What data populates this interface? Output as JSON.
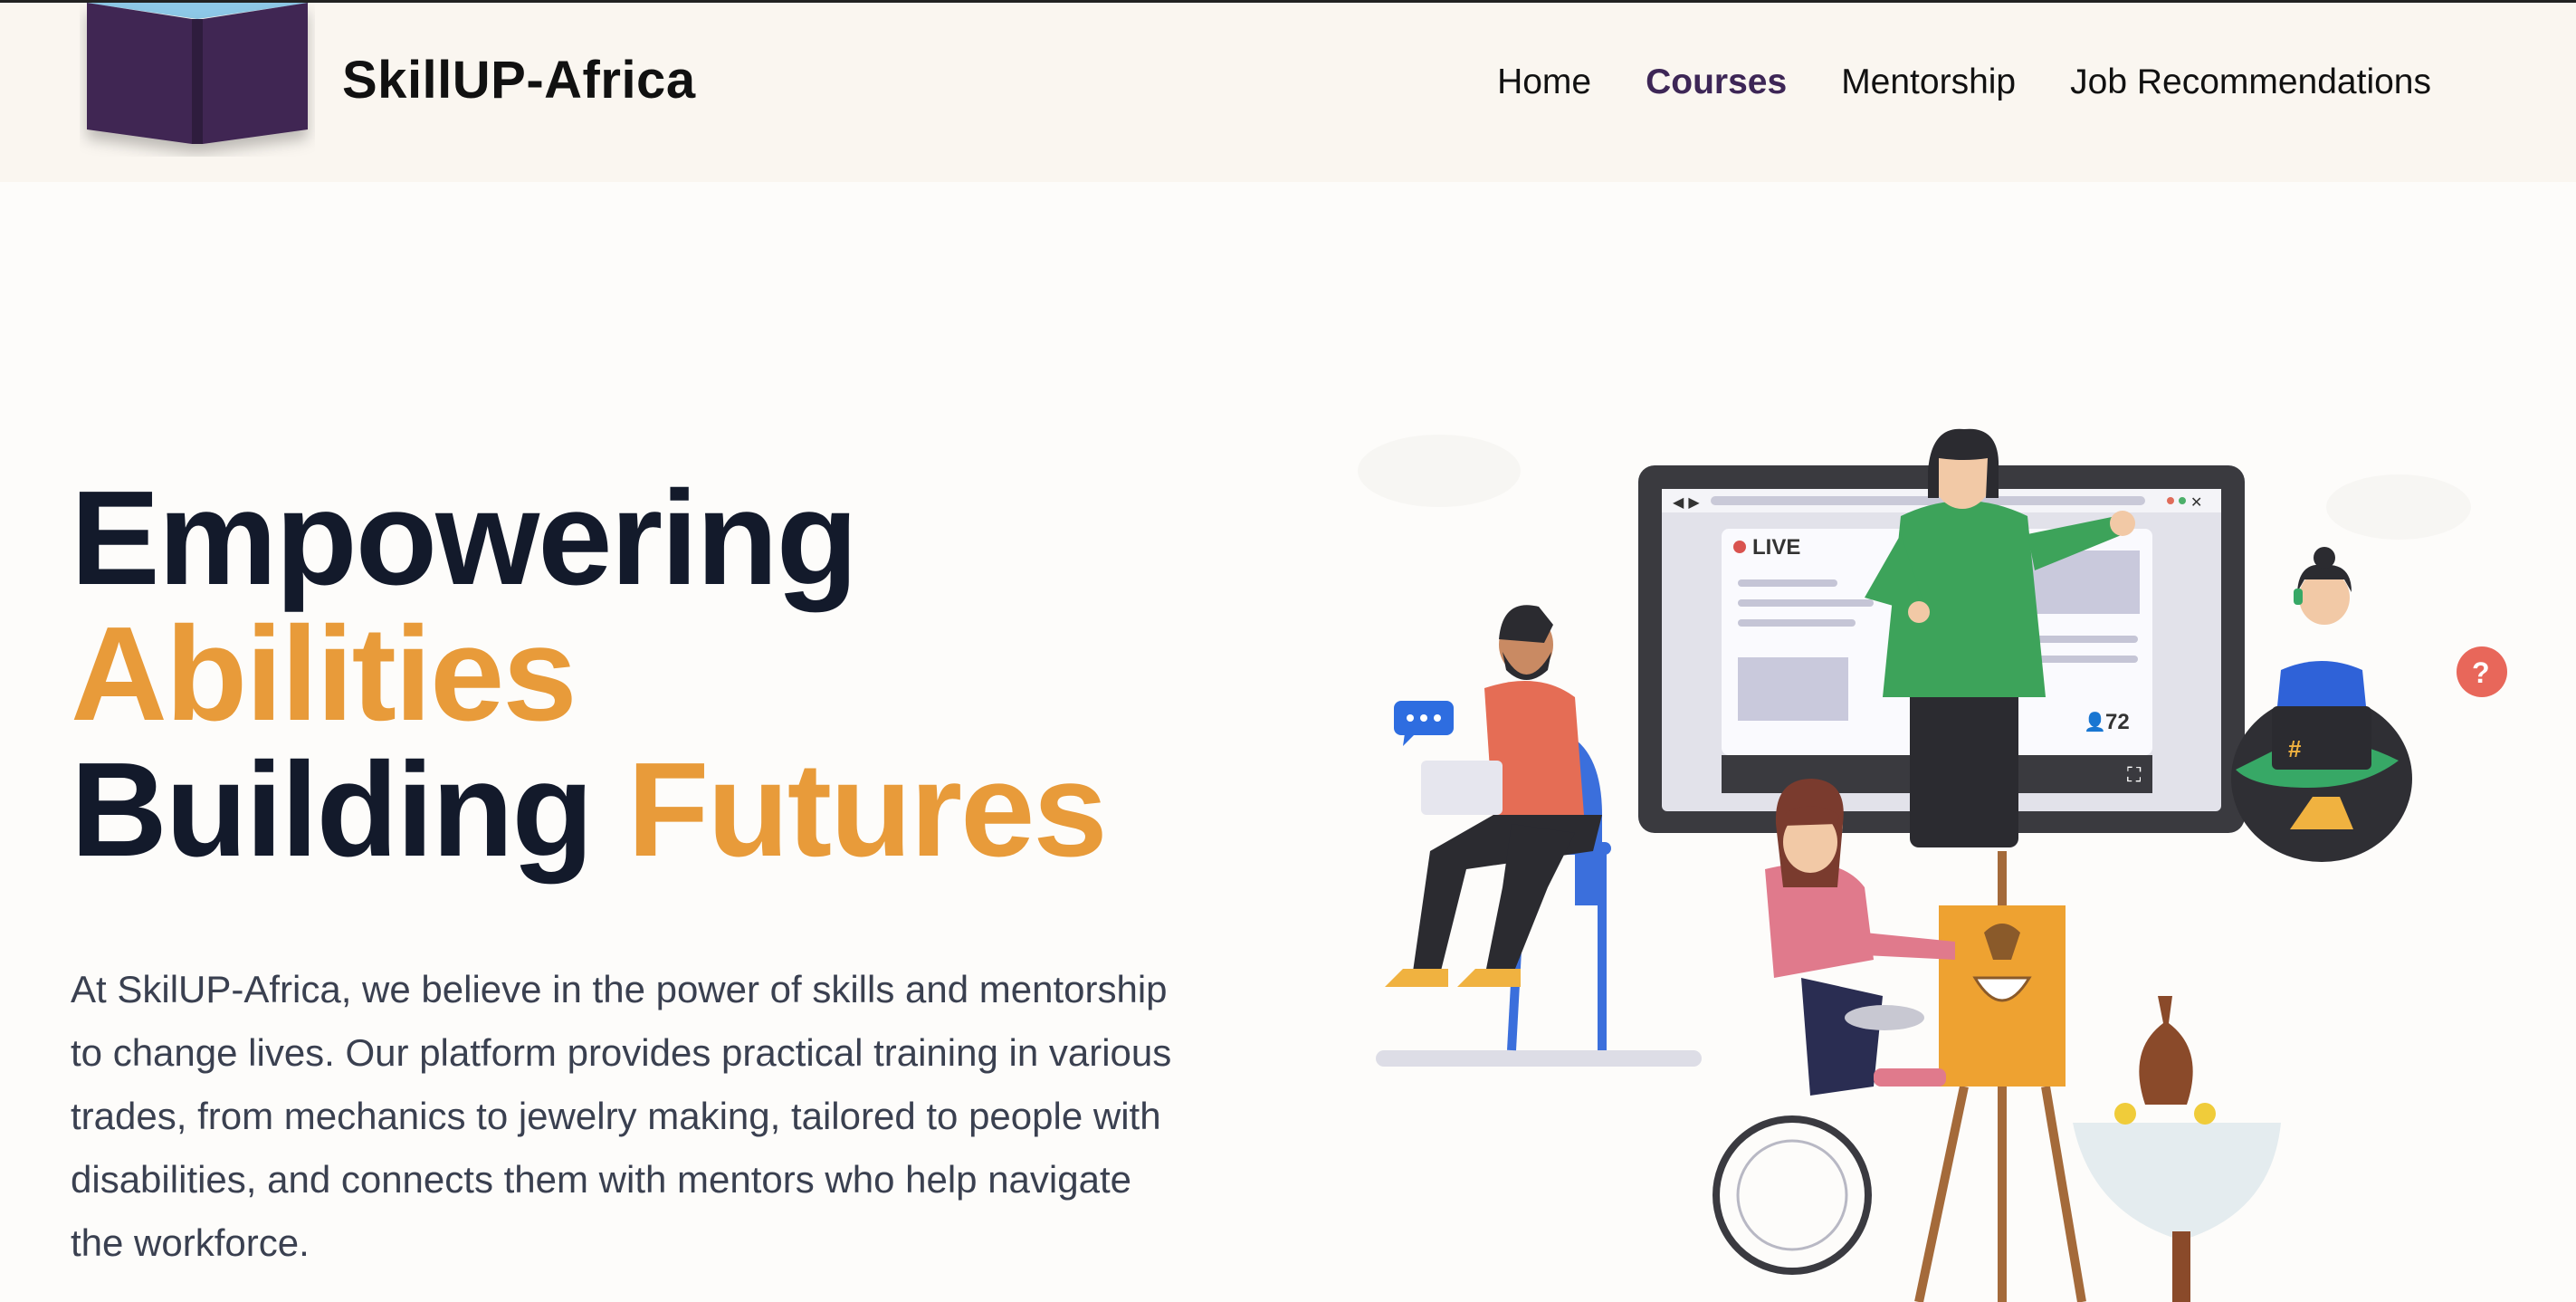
{
  "brand": {
    "name": "SkillUP-Africa",
    "logo_icon": "book-icon"
  },
  "nav": {
    "items": [
      {
        "label": "Home",
        "active": false
      },
      {
        "label": "Courses",
        "active": true
      },
      {
        "label": "Mentorship",
        "active": false
      },
      {
        "label": "Job Recommendations",
        "active": false
      }
    ]
  },
  "hero": {
    "line1": "Empowering",
    "line2_accent": "Abilities",
    "line3_word": "Building",
    "line3_accent": "Futures",
    "description": "At SkilUP-Africa, we believe in the power of skills and mentorship to change lives. Our platform provides practical training in various trades, from mechanics to jewelry making, tailored to people with disabilities, and connects them with mentors who help navigate the workforce."
  },
  "illustration": {
    "live_label": "LIVE",
    "viewer_count": "72",
    "chat_icon": "chat-bubble-icon",
    "question_icon": "question-bubble-icon",
    "hashtag": "#"
  },
  "colors": {
    "accent": "#e89b3a",
    "nav_active": "#3d2656",
    "heading": "#131a2b",
    "header_bg": "#faf6f0"
  }
}
